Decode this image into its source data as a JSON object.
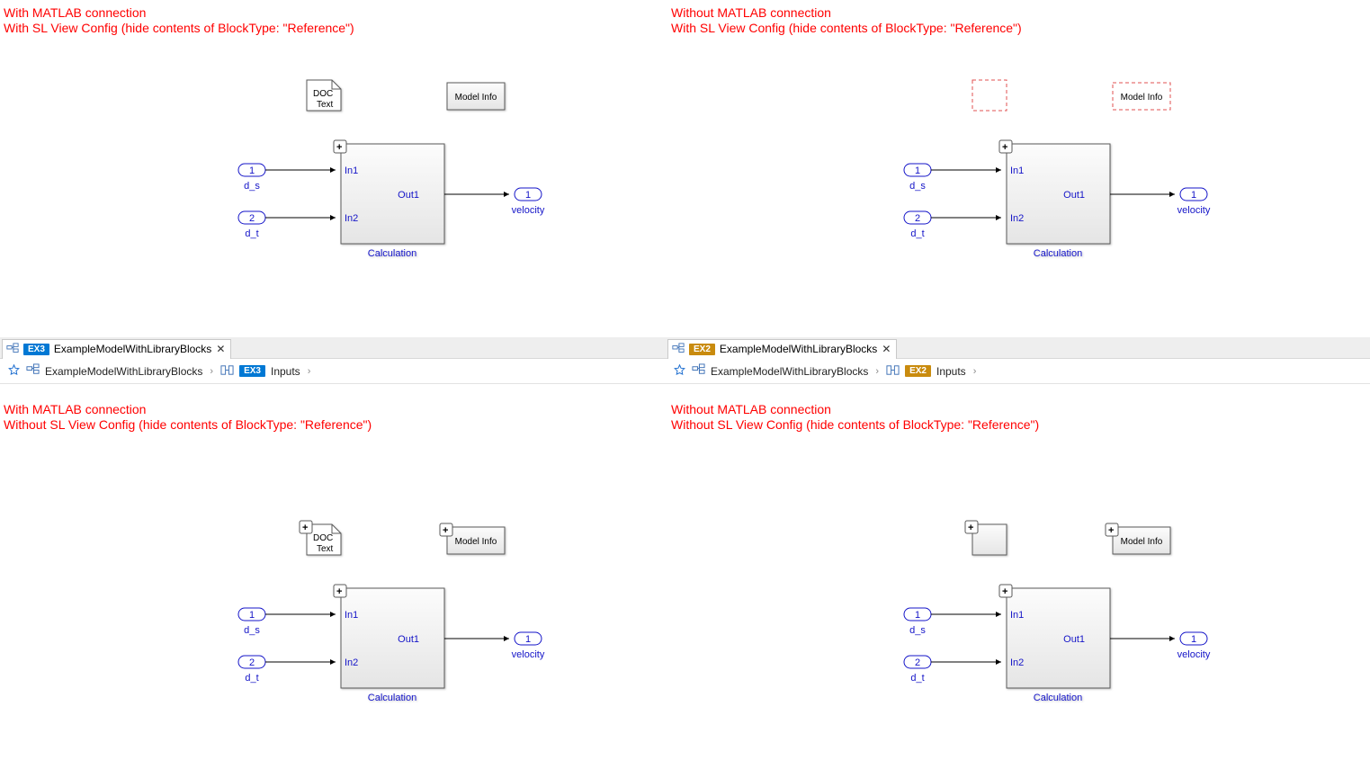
{
  "captions": {
    "tl_line1": "With MATLAB connection",
    "tl_line2": "With SL View Config (hide contents of BlockType: \"Reference\")",
    "tr_line1": "Without MATLAB connection",
    "tr_line2": "With SL View Config (hide contents of BlockType: \"Reference\")",
    "bl_line1": "With MATLAB connection",
    "bl_line2": "Without SL View Config (hide contents of BlockType: \"Reference\")",
    "br_line1": "Without MATLAB connection",
    "br_line2": "Without SL View Config (hide contents of BlockType: \"Reference\")"
  },
  "tabs": {
    "bl": {
      "tag": "EX3",
      "label": "ExampleModelWithLibraryBlocks"
    },
    "br": {
      "tag": "EX2",
      "label": "ExampleModelWithLibraryBlocks"
    }
  },
  "breadcrumbs": {
    "bl": {
      "root": "ExampleModelWithLibraryBlocks",
      "tag": "EX3",
      "leaf": "Inputs"
    },
    "br": {
      "root": "ExampleModelWithLibraryBlocks",
      "tag": "EX2",
      "leaf": "Inputs"
    }
  },
  "sim": {
    "in1_num": "1",
    "in1_label": "d_s",
    "in2_num": "2",
    "in2_label": "d_t",
    "out1_num": "1",
    "out1_label": "velocity",
    "calc_label": "Calculation",
    "port_in1": "In1",
    "port_in2": "In2",
    "port_out1": "Out1",
    "doc_line1": "DOC",
    "doc_line2": "Text",
    "modelinfo": "Model Info",
    "expand": "+"
  }
}
